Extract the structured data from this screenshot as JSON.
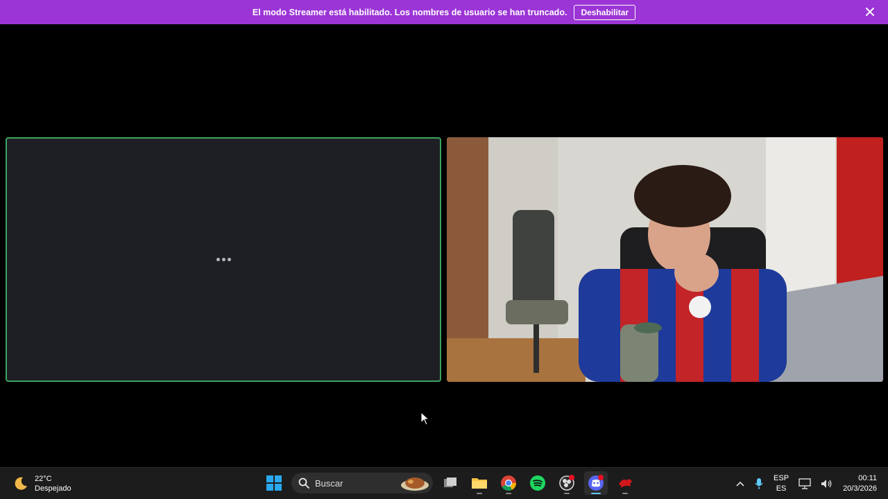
{
  "banner": {
    "message": "El modo Streamer está habilitado. Los nombres de usuario se han truncado.",
    "button_label": "Deshabilitar"
  },
  "taskbar": {
    "weather": {
      "temp": "22°C",
      "condition": "Despejado"
    },
    "search_label": "Buscar",
    "lang": {
      "primary": "ESP",
      "secondary": "ES"
    },
    "clock": {
      "time": "00:11",
      "date": "20/3/2026"
    }
  },
  "colors": {
    "banner_bg": "#9b35d6",
    "speaking_border": "#3ba55d",
    "tile_bg": "#1e1f24",
    "taskbar_bg": "#1c1c1c"
  }
}
